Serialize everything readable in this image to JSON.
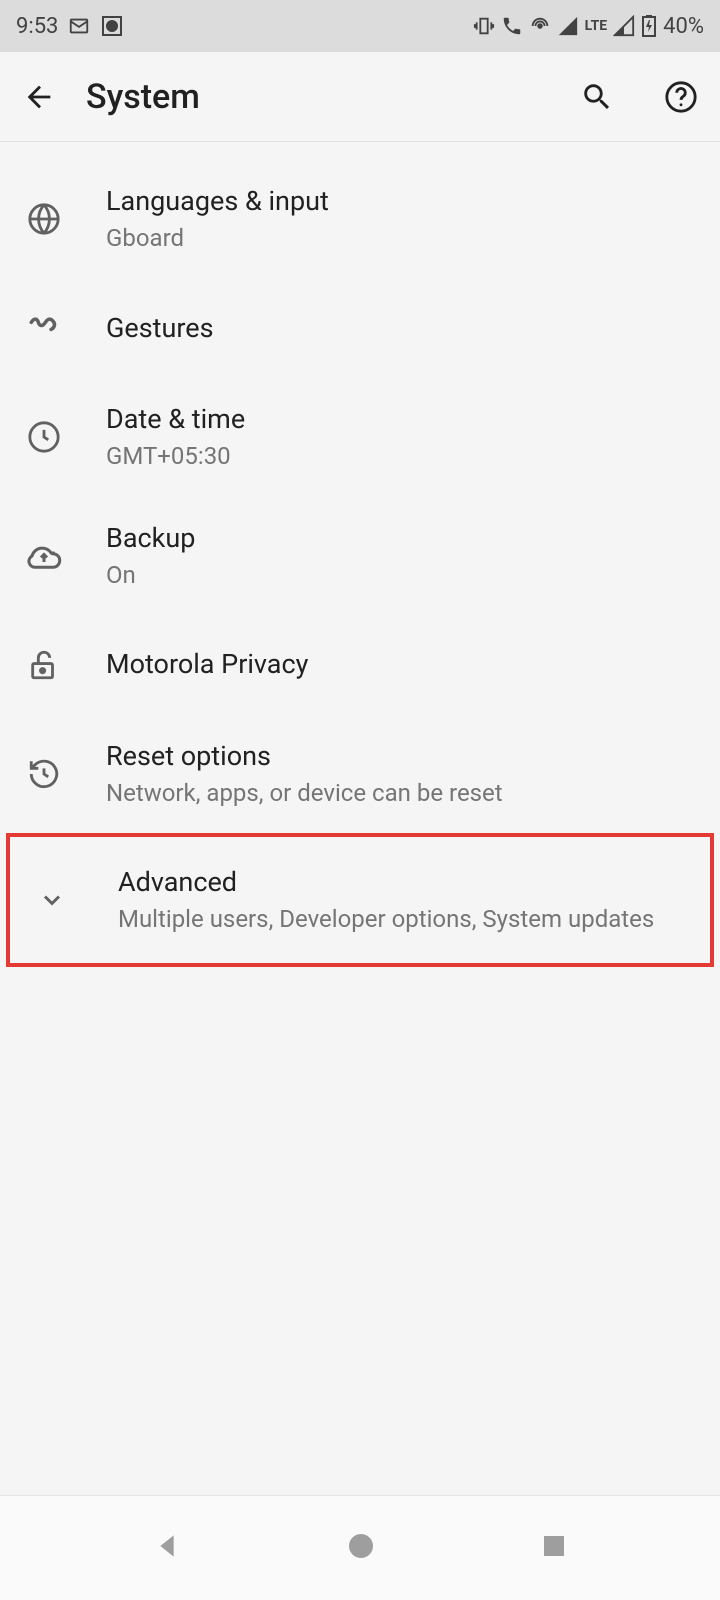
{
  "statusBar": {
    "time": "9:53",
    "battery": "40%",
    "network": "LTE"
  },
  "appBar": {
    "title": "System"
  },
  "items": [
    {
      "title": "Languages & input",
      "subtitle": "Gboard"
    },
    {
      "title": "Gestures",
      "subtitle": ""
    },
    {
      "title": "Date & time",
      "subtitle": "GMT+05:30"
    },
    {
      "title": "Backup",
      "subtitle": "On"
    },
    {
      "title": "Motorola Privacy",
      "subtitle": ""
    },
    {
      "title": "Reset options",
      "subtitle": "Network, apps, or device can be reset"
    },
    {
      "title": "Advanced",
      "subtitle": "Multiple users, Developer options, System updates"
    }
  ]
}
